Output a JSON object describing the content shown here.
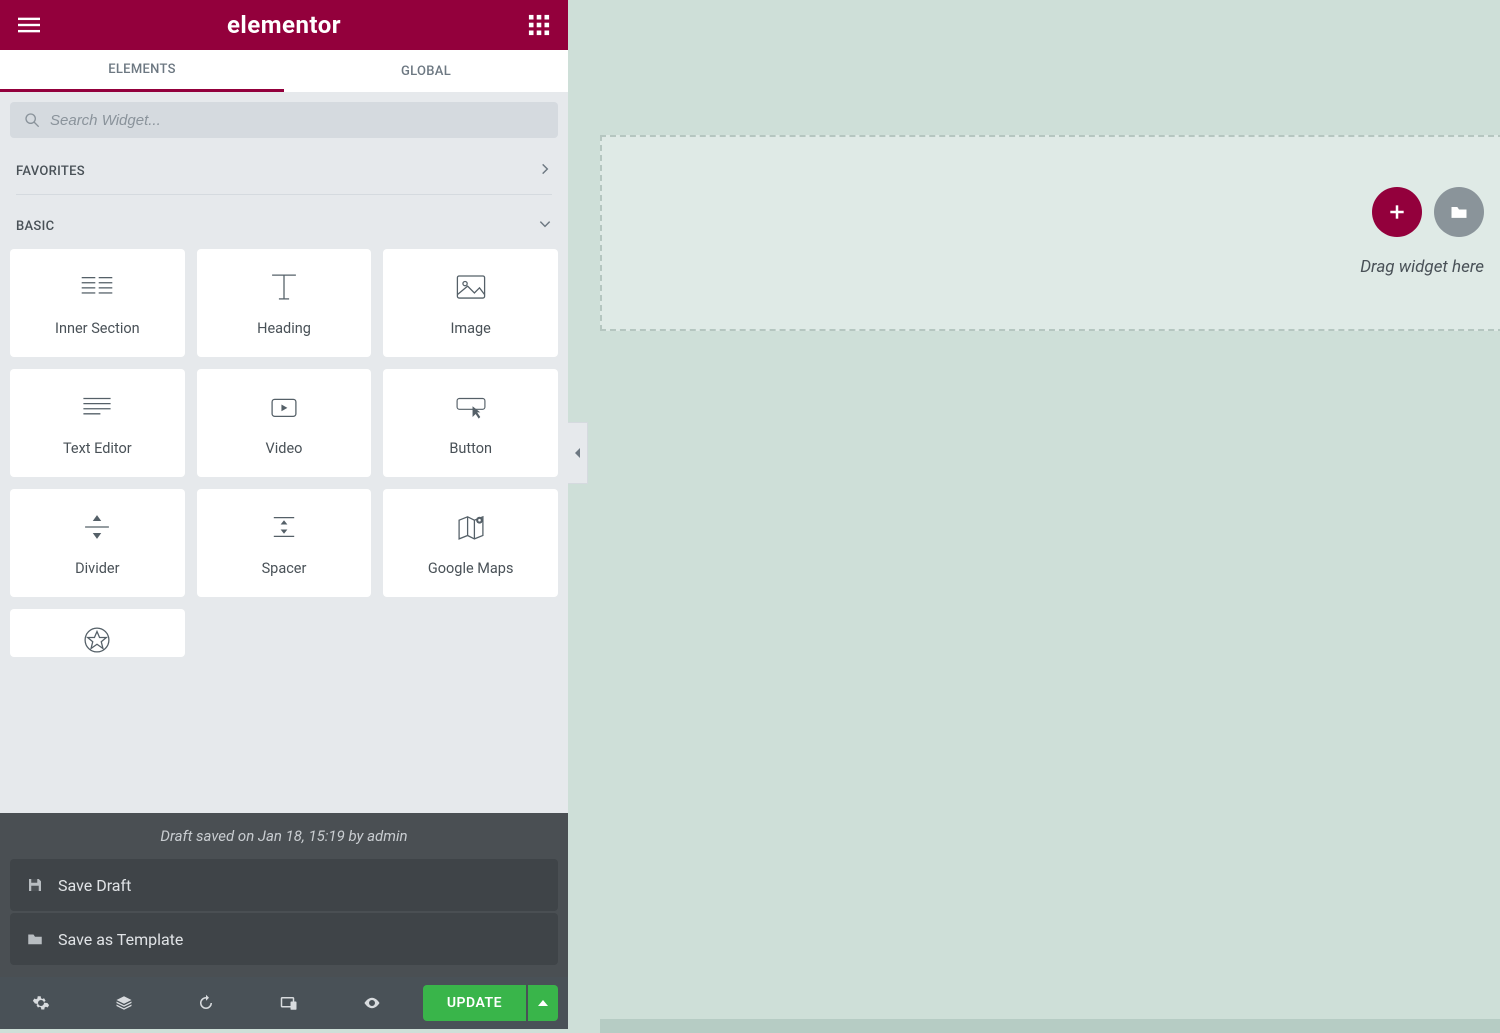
{
  "header": {
    "brand": "elementor"
  },
  "tabs": {
    "elements": "ELEMENTS",
    "global": "GLOBAL"
  },
  "search": {
    "placeholder": "Search Widget..."
  },
  "categories": {
    "favorites": "FAVORITES",
    "basic": "BASIC"
  },
  "widgets": [
    {
      "name": "inner-section",
      "label": "Inner Section"
    },
    {
      "name": "heading",
      "label": "Heading"
    },
    {
      "name": "image",
      "label": "Image"
    },
    {
      "name": "text-editor",
      "label": "Text Editor"
    },
    {
      "name": "video",
      "label": "Video"
    },
    {
      "name": "button",
      "label": "Button"
    },
    {
      "name": "divider",
      "label": "Divider"
    },
    {
      "name": "spacer",
      "label": "Spacer"
    },
    {
      "name": "google-maps",
      "label": "Google Maps"
    }
  ],
  "save": {
    "status": "Draft saved on Jan 18, 15:19 by admin",
    "draft": "Save Draft",
    "template": "Save as Template"
  },
  "footer": {
    "update": "UPDATE"
  },
  "canvas": {
    "drop_hint": "Drag widget here"
  },
  "colors": {
    "brand": "#93003c",
    "update": "#39b54a"
  }
}
